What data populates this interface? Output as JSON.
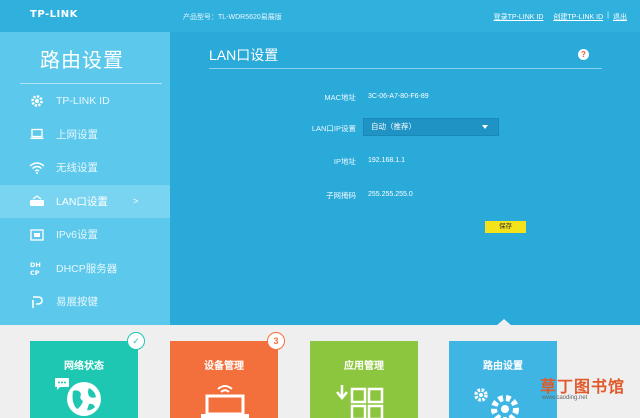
{
  "header": {
    "logo": "TP-LINK",
    "model": "产品型号：TL-WDR5620易展版",
    "login_link": "登录TP-LINK ID",
    "create_link": "创建TP-LINK ID",
    "exit_link": "退出"
  },
  "sidebar": {
    "title": "路由设置",
    "items": [
      {
        "label": "TP-LINK ID",
        "icon": "gear-icon"
      },
      {
        "label": "上网设置",
        "icon": "laptop-icon"
      },
      {
        "label": "无线设置",
        "icon": "wifi-icon"
      },
      {
        "label": "LAN口设置",
        "icon": "router-icon",
        "active": true,
        "arrow": ">"
      },
      {
        "label": "IPv6设置",
        "icon": "ipv6-icon"
      },
      {
        "label": "DHCP服务器",
        "icon": "dhcp-icon"
      },
      {
        "label": "易展按键",
        "icon": "expand-key-icon"
      }
    ]
  },
  "main": {
    "title": "LAN口设置",
    "help": "?",
    "mac_label": "MAC地址",
    "mac_value": "3C-06-A7-80-F6-89",
    "ipmode_label": "LAN口IP设置",
    "ipmode_value": "自动（推荐）",
    "ip_label": "IP地址",
    "ip_value": "192.168.1.1",
    "mask_label": "子网掩码",
    "mask_value": "255.255.255.0",
    "save_label": "保存"
  },
  "tiles": [
    {
      "label": "网络状态",
      "color": "#1ec7b1",
      "badge": "✓"
    },
    {
      "label": "设备管理",
      "color": "#f36f3c",
      "badge": "3"
    },
    {
      "label": "应用管理",
      "color": "#8cc63f"
    },
    {
      "label": "路由设置",
      "color": "#3fb5e3"
    }
  ],
  "watermark": {
    "text": "草丁图书馆",
    "url": "www.caoding.net"
  }
}
